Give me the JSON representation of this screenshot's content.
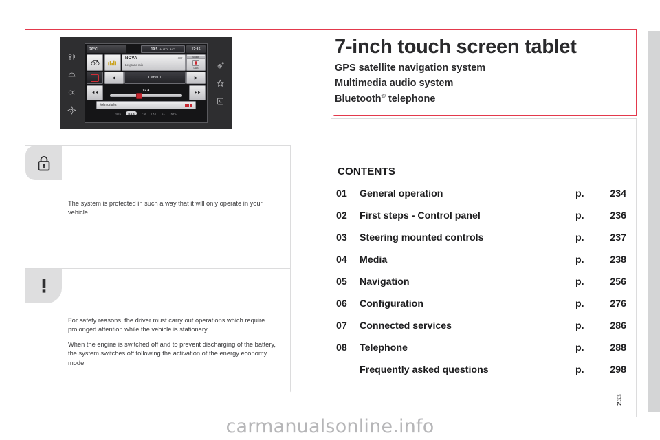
{
  "header": {
    "title": "7-inch touch screen tablet",
    "subtitles": [
      "GPS satellite navigation system",
      "Multimedia audio system",
      "Bluetooth® telephone"
    ],
    "bluetooth_text": "Bluetooth",
    "bluetooth_sup": "®",
    "bluetooth_rest": " telephone",
    "accent_color": "#e3394c"
  },
  "device": {
    "alt": "car infotainment 7-inch touch screen showing radio media screen",
    "screen": {
      "outside_temp": "26°C",
      "climate": "19.5",
      "climate_auto": "AUTO",
      "climate_ac": "A/C",
      "clock": "12:15",
      "station_name": "NOVA",
      "station_sub": "Le grand mix",
      "info_right": "SRT",
      "source_label": "Source",
      "source_value": "DAB",
      "band": "Canal 1",
      "frequency": "12 A",
      "memory_label": "Mémorisés",
      "back_icon": "return-icon",
      "prev_icon": "◀",
      "next_icon": "▶",
      "skip_prev_icon": "◄◄",
      "skip_next_icon": "►►",
      "status_items": [
        "RDS",
        "DAB",
        "FM",
        "TXT",
        "SL",
        "INFO"
      ]
    },
    "bezel_left_icons": [
      "climate-icon",
      "vehicle-icon",
      "driving-aids-icon",
      "navigation-icon"
    ],
    "bezel_right_icons": [
      "settings-icon",
      "apps-icon",
      "phone-icon"
    ]
  },
  "notes": [
    {
      "icon": "lock-icon",
      "paragraphs": [
        "The system is protected in such a way that it will only operate in your vehicle."
      ]
    },
    {
      "icon": "warning-exclamation-icon",
      "paragraphs": [
        "For safety reasons, the driver must carry out operations which require prolonged attention while the vehicle is stationary.",
        "When the engine is switched off and to prevent discharging of the battery, the system switches off following the activation of the energy economy mode."
      ]
    }
  ],
  "contents": {
    "title": "CONTENTS",
    "page_prefix": "p.",
    "entries": [
      {
        "num": "01",
        "label": "General operation",
        "prefix": "p.",
        "page": "234"
      },
      {
        "num": "02",
        "label": "First steps - Control panel",
        "prefix": "p.",
        "page": "236"
      },
      {
        "num": "03",
        "label": "Steering mounted controls",
        "prefix": "p.",
        "page": "237"
      },
      {
        "num": "04",
        "label": "Media",
        "prefix": "p.",
        "page": "238"
      },
      {
        "num": "05",
        "label": "Navigation",
        "prefix": "p.",
        "page": "256"
      },
      {
        "num": "06",
        "label": "Configuration",
        "prefix": "p.",
        "page": "276"
      },
      {
        "num": "07",
        "label": "Connected services",
        "prefix": "p.",
        "page": "286"
      },
      {
        "num": "08",
        "label": "Telephone",
        "prefix": "p.",
        "page": "288"
      },
      {
        "num": "",
        "label": "Frequently asked questions",
        "prefix": "p.",
        "page": "298"
      }
    ]
  },
  "footer": {
    "watermark": "carmanualsonline.info",
    "page_number": "233"
  }
}
